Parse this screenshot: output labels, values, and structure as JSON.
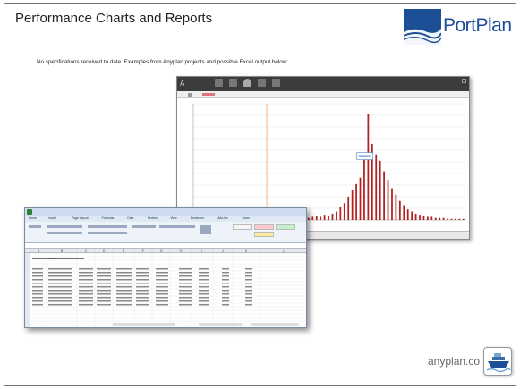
{
  "slide": {
    "title": "Performance Charts and Reports",
    "subtitle": "No specifications received to date. Examples from Anyplan projects and possible Excel output below:",
    "footer_url": "anyplan.co"
  },
  "logo": {
    "text": "PortPlan",
    "brand_color": "#1d4f96"
  },
  "anyplan_window": {
    "toolbar_icons": [
      "back-icon",
      "grid-icon",
      "list-icon",
      "user-icon",
      "box-icon",
      "chart-icon"
    ],
    "series_color": "#b22222",
    "marker_color": "#f4a460"
  },
  "chart_data": {
    "type": "bar",
    "values": [
      2,
      2,
      3,
      2,
      3,
      2,
      4,
      3,
      2,
      3,
      4,
      3,
      5,
      4,
      6,
      8,
      12,
      16,
      22,
      28,
      34,
      40,
      58,
      100,
      72,
      62,
      56,
      46,
      38,
      30,
      24,
      18,
      14,
      10,
      8,
      6,
      5,
      4,
      3,
      3,
      2,
      2,
      2,
      1,
      1,
      1,
      1,
      1
    ],
    "ylim": [
      0,
      110
    ],
    "grid": true
  },
  "excel": {
    "menu_tabs": [
      "Home",
      "Insert",
      "Page Layout",
      "Formulas",
      "Data",
      "Review",
      "View",
      "Developer",
      "Add-Ins",
      "Team"
    ],
    "columns": [
      "A",
      "B",
      "C",
      "D",
      "E",
      "F",
      "G",
      "H",
      "I",
      "J",
      "K",
      "L"
    ],
    "style_colors": [
      "#f6f6f6",
      "#ffc7ce",
      "#c6efce",
      "#ffeb9c"
    ]
  }
}
